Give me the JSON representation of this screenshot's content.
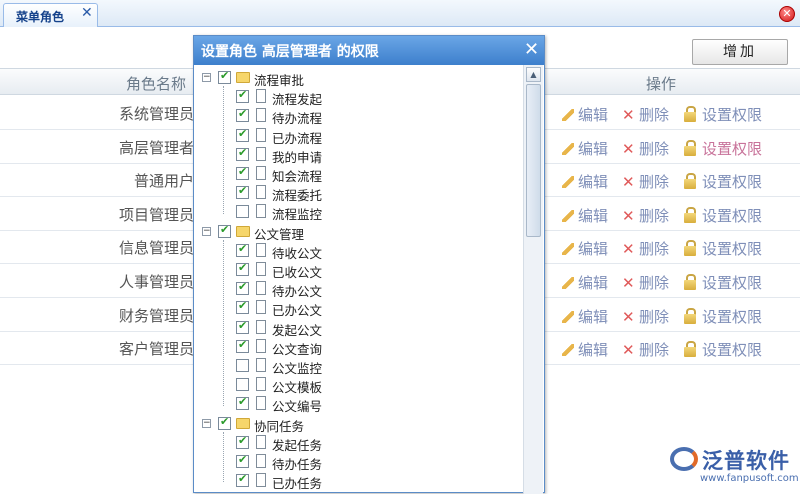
{
  "tab": {
    "label": "菜单角色",
    "close": "✕"
  },
  "window": {
    "close": "✕"
  },
  "toolbar": {
    "add_label": "增加"
  },
  "table": {
    "headers": {
      "name": "角色名称",
      "ops": "操作"
    },
    "rows": [
      {
        "name": "系统管理员",
        "perm_highlight": false
      },
      {
        "name": "高层管理者",
        "perm_highlight": true
      },
      {
        "name": "普通用户",
        "perm_highlight": false
      },
      {
        "name": "项目管理员",
        "perm_highlight": false
      },
      {
        "name": "信息管理员",
        "perm_highlight": false
      },
      {
        "name": "人事管理员",
        "perm_highlight": false
      },
      {
        "name": "财务管理员",
        "perm_highlight": false
      },
      {
        "name": "客户管理员",
        "perm_highlight": false
      }
    ],
    "ops": {
      "edit": "编辑",
      "delete": "删除",
      "perm": "设置权限"
    }
  },
  "dialog": {
    "title": "设置角色 高层管理者 的权限",
    "close": "✕",
    "groups": [
      {
        "label": "流程审批",
        "checked": true,
        "items": [
          {
            "label": "流程发起",
            "checked": true
          },
          {
            "label": "待办流程",
            "checked": true
          },
          {
            "label": "已办流程",
            "checked": true
          },
          {
            "label": "我的申请",
            "checked": true
          },
          {
            "label": "知会流程",
            "checked": true
          },
          {
            "label": "流程委托",
            "checked": true
          },
          {
            "label": "流程监控",
            "checked": false
          }
        ]
      },
      {
        "label": "公文管理",
        "checked": true,
        "items": [
          {
            "label": "待收公文",
            "checked": true
          },
          {
            "label": "已收公文",
            "checked": true
          },
          {
            "label": "待办公文",
            "checked": true
          },
          {
            "label": "已办公文",
            "checked": true
          },
          {
            "label": "发起公文",
            "checked": true
          },
          {
            "label": "公文查询",
            "checked": true
          },
          {
            "label": "公文监控",
            "checked": false
          },
          {
            "label": "公文模板",
            "checked": false
          },
          {
            "label": "公文编号",
            "checked": true
          }
        ]
      },
      {
        "label": "协同任务",
        "checked": true,
        "items": [
          {
            "label": "发起任务",
            "checked": true
          },
          {
            "label": "待办任务",
            "checked": true
          },
          {
            "label": "已办任务",
            "checked": true
          }
        ]
      }
    ]
  },
  "icons": [
    "close-icon",
    "pencil-icon",
    "delete-x-icon",
    "lock-icon",
    "folder-icon",
    "page-icon",
    "checkbox-icon",
    "collapse-icon",
    "scroll-up-icon"
  ],
  "colors": {
    "title_bar": "#3d7fcc",
    "link": "#7f8fb8",
    "delete": "#e05a5a",
    "highlight": "#c8739a"
  },
  "logo": {
    "name": "泛普软件",
    "url": "www.fanpusoft.com"
  }
}
